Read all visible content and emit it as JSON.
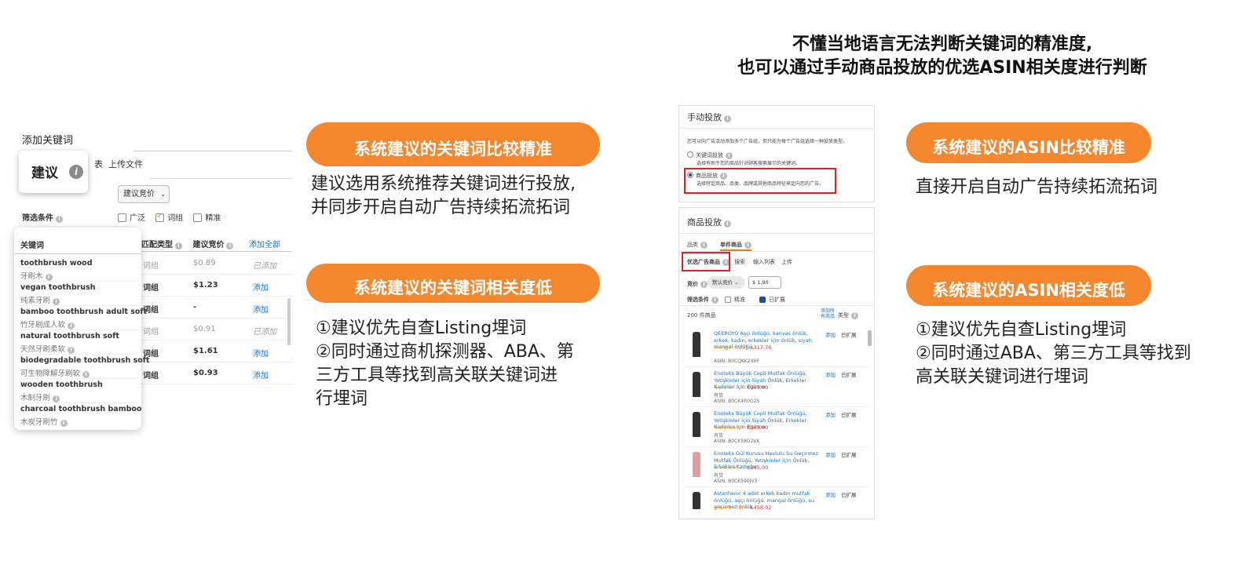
{
  "headline": {
    "line1": "不懂当地语言无法判断关键词的精准度,",
    "line2": "也可以通过手动商品投放的优选ASIN相关度进行判断"
  },
  "left_panel": {
    "title": "添加关键词",
    "tab_rest": "表",
    "tab_upload": "上传文件",
    "bid_select": "建议竞价",
    "filter_label": "筛选条件",
    "filter_options": [
      "广泛",
      "词组",
      "精准"
    ],
    "table_headers": [
      "匹配类型",
      "建议竞价",
      "添加全部"
    ],
    "rows": [
      {
        "match": "词组",
        "bid": "$0.89",
        "action": "已添加",
        "added": true
      },
      {
        "match": "词组",
        "bid": "$1.23",
        "action": "添加",
        "added": false
      },
      {
        "match": "词组",
        "bid": "-",
        "action": "添加",
        "added": false
      },
      {
        "match": "词组",
        "bid": "$0.91",
        "action": "已添加",
        "added": true
      },
      {
        "match": "词组",
        "bid": "$1.61",
        "action": "添加",
        "added": false
      },
      {
        "match": "词组",
        "bid": "$0.93",
        "action": "添加",
        "added": false
      }
    ],
    "suggest_badge": "建议",
    "overlay_header": "关键词",
    "keywords": [
      {
        "en": "toothbrush wood",
        "zh": "牙刷木"
      },
      {
        "en": "vegan toothbrush",
        "zh": "纯素牙刷"
      },
      {
        "en": "bamboo toothbrush adult soft",
        "zh": "竹牙刷成人软"
      },
      {
        "en": "natural toothbrush soft",
        "zh": "天然牙刷柔软"
      },
      {
        "en": "biodegradable toothbrush soft",
        "zh": "可生物降解牙刷软"
      },
      {
        "en": "wooden toothbrush",
        "zh": "木制牙刷"
      },
      {
        "en": "charcoal toothbrush bamboo",
        "zh": "木炭牙刷竹"
      }
    ]
  },
  "callouts_left": {
    "pill1": "系统建议的关键词比较精准",
    "desc1_l1": "建议选用系统推荐关键词进行投放,",
    "desc1_l2": "并同步开启自动广告持续拓流拓词",
    "pill2": "系统建议的关键词相关度低",
    "desc2_l1": "①建议优先自查Listing埋词",
    "desc2_l2": "②同时通过商机探测器、ABA、第",
    "desc2_l3": "三方工具等找到高关联关键词进",
    "desc2_l4": "行埋词"
  },
  "right_panel": {
    "manual_title": "手动投放",
    "manual_desc": "您可以向广告活动添加多个广告组，但只能为每个广告组选择一种投放类型。",
    "radio1": "关键词投放",
    "radio1_desc": "选择有助于您的商品针对顾客搜索展示的关键词。",
    "radio2": "商品投放",
    "radio2_desc": "选择特定商品、品类、品牌或其他商品特征来定向您的广告。",
    "product_title": "商品投放",
    "tab_category": "品类",
    "tab_single": "单件商品",
    "subtab_suggested": "优选广告商品",
    "subtab_search": "搜索",
    "subtab_enter": "输入列表",
    "subtab_upload": "上传",
    "bid_label": "竞价",
    "bid_select": "默认竞价",
    "bid_value": "$ 1,90",
    "filter_label": "筛选条件",
    "filter_exact": "精准",
    "filter_expanded": "已扩展",
    "count": "200 件商品",
    "add_all": "添加所有商品",
    "type_col": "类型",
    "products": [
      {
        "title": "QEEROYO Aşçı önlüğü, kanvas önlük, erkek, kadın, erkekler için önlük, siyah, mangal önlüğü,",
        "rating": "★★★★☆(25)",
        "price": "₺317,76",
        "shipping": "",
        "asin": "ASIN: B0CQKK2X6F",
        "add": "添加",
        "type": "已扩展"
      },
      {
        "title": "Enoteks Büyük Cepli Mutfak Önlüğü, Yetişkinler için Siyah Önlük, Erkekler Kadınlar için Pişirme",
        "rating": "★★★★☆(2)",
        "price": "₺265,00",
        "shipping": "有货",
        "asin": "ASIN: B0CK4R0G2S",
        "add": "添加",
        "type": "已扩展"
      },
      {
        "title": "Enoteks Büyük Cepli Mutfak Önlüğü, Yetişkinler için Siyah Önlük, Erkekler Kadınlar için Pişirme",
        "rating": "★★★★★(1)",
        "price": "₺265,00",
        "shipping": "有货",
        "asin": "ASIN: B0CK58G2VK",
        "add": "添加",
        "type": "已扩展"
      },
      {
        "title": "Enoteks Gül Kurusu Havlulu Su Geçirmez Mutfak Önlüğü, Yetişkinler için Önlük, Erkekler Kadınlar",
        "rating": "★★★★★(1)",
        "price": "₺245,00",
        "shipping": "有货",
        "asin": "ASIN: B0CK590JV3",
        "add": "添加",
        "type": "已扩展"
      },
      {
        "title": "AsterFavor 4 adet erkek kadın mutfak önlüğü, aşçı önlüğü, mangal önlüğü, su geçirmez önlük",
        "rating": "★★★★☆(17)",
        "price": "₺458,02",
        "shipping": "",
        "asin": "",
        "add": "添加",
        "type": "已扩展"
      }
    ]
  },
  "callouts_right": {
    "pill1": "系统建议的ASIN比较精准",
    "desc1": "直接开启自动广告持续拓流拓词",
    "pill2": "系统建议的ASIN相关度低",
    "desc2_l1": "①建议优先自查Listing埋词",
    "desc2_l2": "②同时通过ABA、第三方工具等找到",
    "desc2_l3": "高关联关键词进行埋词"
  },
  "colors": {
    "accent_orange": "#f4862e",
    "link_blue": "#1a73c8",
    "highlight_red": "#e02020"
  }
}
